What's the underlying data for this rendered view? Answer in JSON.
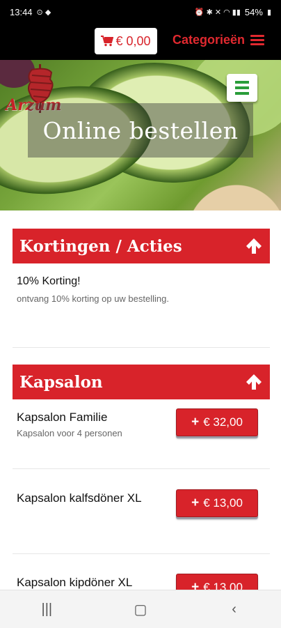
{
  "status_bar": {
    "time": "13:44",
    "battery": "54%"
  },
  "header": {
    "cart_amount": "€ 0,00",
    "categories_label": "Categorieën"
  },
  "hero": {
    "logo_text": "Arzum",
    "title": "Online bestellen"
  },
  "sections": [
    {
      "title": "Kortingen / Acties",
      "promo": {
        "title": "10% Korting!",
        "description": "ontvang 10% korting op uw bestelling."
      }
    },
    {
      "title": "Kapsalon",
      "items": [
        {
          "name": "Kapsalon Familie",
          "description": "Kapsalon voor 4 personen",
          "price": "€ 32,00"
        },
        {
          "name": "Kapsalon kalfsdöner XL",
          "description": "",
          "price": "€ 13,00"
        },
        {
          "name": "Kapsalon kipdöner XL",
          "description": "",
          "price": "€ 13,00"
        }
      ]
    }
  ],
  "colors": {
    "brand_red": "#d8232a",
    "menu_green": "#2a9d3a"
  }
}
